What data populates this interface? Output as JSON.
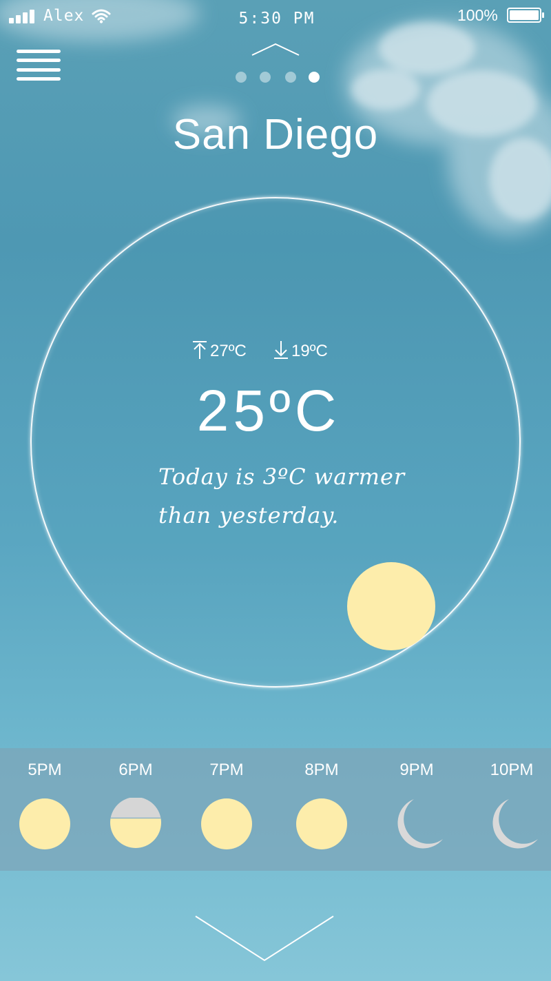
{
  "status_bar": {
    "carrier": "Alex",
    "time": "5:30 PM",
    "battery_percent": "100%",
    "signal_icon": "signal-bars-icon",
    "wifi_icon": "wifi-icon",
    "battery_icon": "battery-icon"
  },
  "navigation": {
    "menu_icon": "hamburger-menu-icon",
    "up_icon": "chevron-up-icon",
    "down_icon": "chevron-down-icon",
    "page_count": 4,
    "active_page": 4
  },
  "location": {
    "city": "San Diego"
  },
  "today": {
    "high": "27ºC",
    "low": "19ºC",
    "high_icon": "arrow-up-to-bar-icon",
    "low_icon": "arrow-down-to-bar-icon",
    "current": "25ºC",
    "comparison_line1": "Today is 3ºC warmer",
    "comparison_line2": "than yesterday.",
    "condition_icon": "sun-icon"
  },
  "hourly": [
    {
      "time": "5PM",
      "icon": "sun-icon"
    },
    {
      "time": "6PM",
      "icon": "partly-cloudy-sun-icon"
    },
    {
      "time": "7PM",
      "icon": "sun-icon"
    },
    {
      "time": "8PM",
      "icon": "sun-icon"
    },
    {
      "time": "9PM",
      "icon": "moon-icon"
    },
    {
      "time": "10PM",
      "icon": "moon-icon"
    }
  ],
  "colors": {
    "background": "#4e98b3",
    "sun": "#fdedab",
    "moon": "#d9d9d9",
    "cloud": "#d6d6d6",
    "text": "#ffffff",
    "hourly_strip": "#7da5b9"
  }
}
